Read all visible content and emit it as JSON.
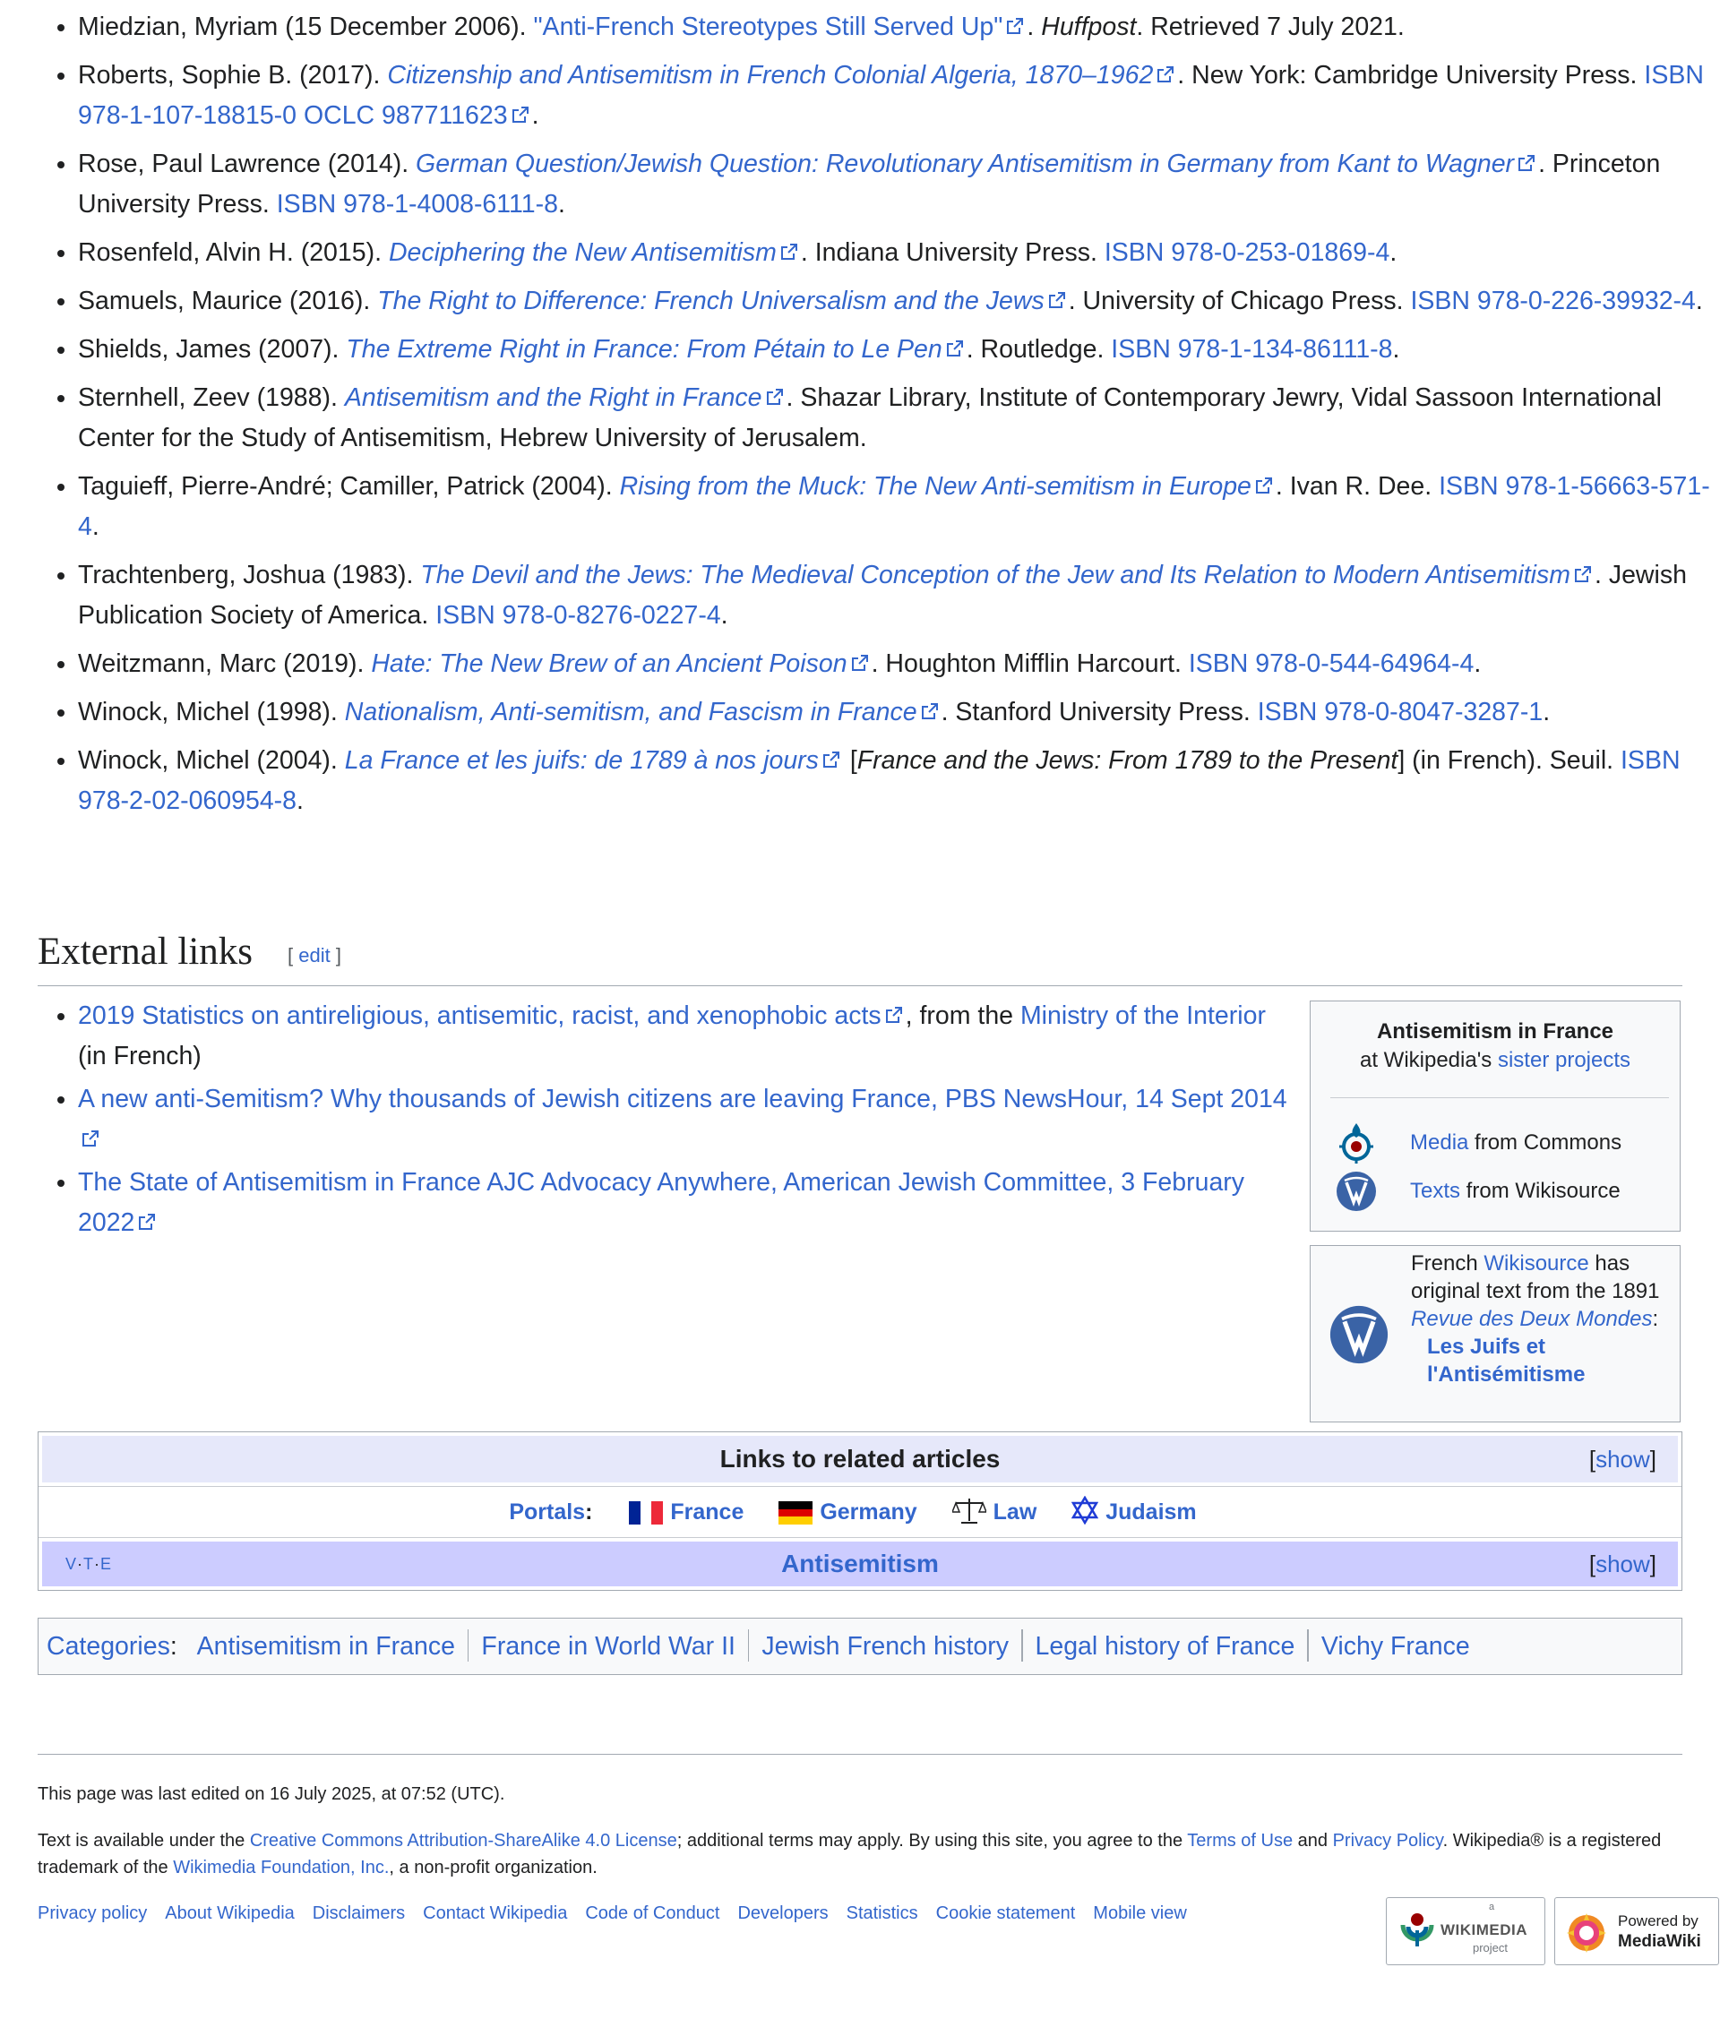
{
  "references": [
    {
      "pre": "Miedzian, Myriam (15 December 2006). ",
      "link": "\"Anti-French Stereotypes Still Served Up\"",
      "link_italic": false,
      "post": ". ",
      "post_italic": "Huffpost",
      "post2": ". Retrieved 7 July 2021."
    },
    {
      "pre": "Roberts, Sophie B. (2017). ",
      "link": "Citizenship and Antisemitism in French Colonial Algeria, 1870–1962",
      "link_italic": true,
      "post": ". New York: Cambridge University Press. ",
      "isbn": "ISBN 978-1-107-18815-0",
      "oclc": "OCLC 987711623"
    },
    {
      "pre": "Rose, Paul Lawrence (2014). ",
      "link": "German Question/Jewish Question: Revolutionary Antisemitism in Germany from Kant to Wagner",
      "link_italic": true,
      "post": ". Princeton University Press. ",
      "isbn": "ISBN 978-1-4008-6111-8"
    },
    {
      "pre": "Rosenfeld, Alvin H. (2015). ",
      "link": "Deciphering the New Antisemitism",
      "link_italic": true,
      "post": ". Indiana University Press. ",
      "isbn": "ISBN 978-0-253-01869-4"
    },
    {
      "pre": "Samuels, Maurice (2016). ",
      "link": "The Right to Difference: French Universalism and the Jews",
      "link_italic": true,
      "post": ". University of Chicago Press. ",
      "isbn": "ISBN 978-0-226-39932-4"
    },
    {
      "pre": "Shields, James (2007). ",
      "link": "The Extreme Right in France: From Pétain to Le Pen",
      "link_italic": true,
      "post": ". Routledge. ",
      "isbn": "ISBN 978-1-134-86111-8"
    },
    {
      "pre": "Sternhell, Zeev (1988). ",
      "link": "Antisemitism and the Right in France",
      "link_italic": true,
      "post": ". Shazar Library, Institute of Contemporary Jewry, Vidal Sassoon International Center for the Study of Antisemitism, Hebrew University of Jerusalem."
    },
    {
      "pre": "Taguieff, Pierre-André; Camiller, Patrick (2004). ",
      "link": "Rising from the Muck: The New Anti-semitism in Europe",
      "link_italic": true,
      "post": ". Ivan R. Dee. ",
      "isbn": "ISBN 978-1-56663-571-4"
    },
    {
      "pre": "Trachtenberg, Joshua (1983). ",
      "link": "The Devil and the Jews: The Medieval Conception of the Jew and Its Relation to Modern Antisemitism",
      "link_italic": true,
      "post": ". Jewish Publication Society of America. ",
      "isbn": "ISBN 978-0-8276-0227-4"
    },
    {
      "pre": "Weitzmann, Marc (2019). ",
      "link": "Hate: The New Brew of an Ancient Poison",
      "link_italic": true,
      "post": ". Houghton Mifflin Harcourt. ",
      "isbn": "ISBN 978-0-544-64964-4"
    },
    {
      "pre": "Winock, Michel (1998). ",
      "link": "Nationalism, Anti-semitism, and Fascism in France",
      "link_italic": true,
      "post": ". Stanford University Press. ",
      "isbn": "ISBN 978-0-8047-3287-1"
    },
    {
      "pre": "Winock, Michel (2004). ",
      "link": "La France et les juifs: de 1789 à nos jours",
      "link_italic": true,
      "post": " [",
      "post_italic": "France and the Jews: From 1789 to the Present",
      "post2": "] (in French). Seuil. ",
      "isbn": "ISBN 978-2-02-060954-8"
    }
  ],
  "external_links": {
    "heading": "External links",
    "edit_open": "[ ",
    "edit_label": "edit",
    "edit_close": " ]",
    "items": [
      {
        "link": "2019 Statistics on antireligious, antisemitic, racist, and xenophobic acts",
        "mid": ", from the ",
        "link2": "Ministry of the Interior",
        "post": " (in French)"
      },
      {
        "link": "A new anti-Semitism? Why thousands of Jewish citizens are leaving France, PBS NewsHour, 14 Sept 2014"
      },
      {
        "link": "The State of Antisemitism in France AJC Advocacy Anywhere, American Jewish Committee, 3 February 2022"
      }
    ]
  },
  "sister": {
    "title": "Antisemitism in France",
    "subtitle_pre": "at Wikipedia's ",
    "subtitle_link": "sister projects",
    "rows": [
      {
        "link": "Media",
        "post": " from Commons",
        "icon": "commons-icon"
      },
      {
        "link": "Texts",
        "post": " from Wikisource",
        "icon": "wikisource-icon"
      }
    ]
  },
  "wikisource": {
    "pre": "French ",
    "link": "Wikisource",
    "mid": " has original text from the 1891 ",
    "italic_link": "Revue des Deux Mondes",
    "colon": ":",
    "bold_link": "Les Juifs et l'Antisémitisme"
  },
  "navbox": {
    "title": "Links to related articles",
    "show_open": "[",
    "show_label": "show",
    "show_close": "]",
    "portals_label": "Portals",
    "portals_colon": ":",
    "portals": [
      "France",
      "Germany",
      "Law",
      "Judaism"
    ],
    "anti_title": "Antisemitism",
    "vte": [
      "V",
      "T",
      "E"
    ],
    "vte_sep": "·"
  },
  "categories": {
    "label": "Categories",
    "colon": ":",
    "items": [
      "Antisemitism in France",
      "France in World War II",
      "Jewish French history",
      "Legal history of France",
      "Vichy France"
    ]
  },
  "footer": {
    "edited": "This page was last edited on 16 July 2025, at 07:52 (UTC).",
    "lic_pre": "Text is available under the ",
    "lic_link": "Creative Commons Attribution-ShareAlike 4.0 License",
    "lic_mid": "; additional terms may apply. By using this site, you agree to the ",
    "terms": "Terms of Use",
    "and": " and ",
    "privacy": "Privacy Policy",
    "lic_mid2": ". Wikipedia® is a registered trademark of the ",
    "foundation": "Wikimedia Foundation, Inc.",
    "lic_post": ", a non-profit organization.",
    "links": [
      "Privacy policy",
      "About Wikipedia",
      "Disclaimers",
      "Contact Wikipedia",
      "Code of Conduct",
      "Developers",
      "Statistics",
      "Cookie statement",
      "Mobile view"
    ],
    "wm_badge": {
      "small": "a",
      "name": "WIKIMEDIA",
      "sub": "project"
    },
    "mw_badge": {
      "line1": "Powered by",
      "line2": "MediaWiki"
    }
  },
  "colors": {
    "link": "#3366cc",
    "text": "#202122",
    "border": "#a2a9b1",
    "navbox_title": "#e6e8fa",
    "navbox_group": "#ccccff"
  }
}
